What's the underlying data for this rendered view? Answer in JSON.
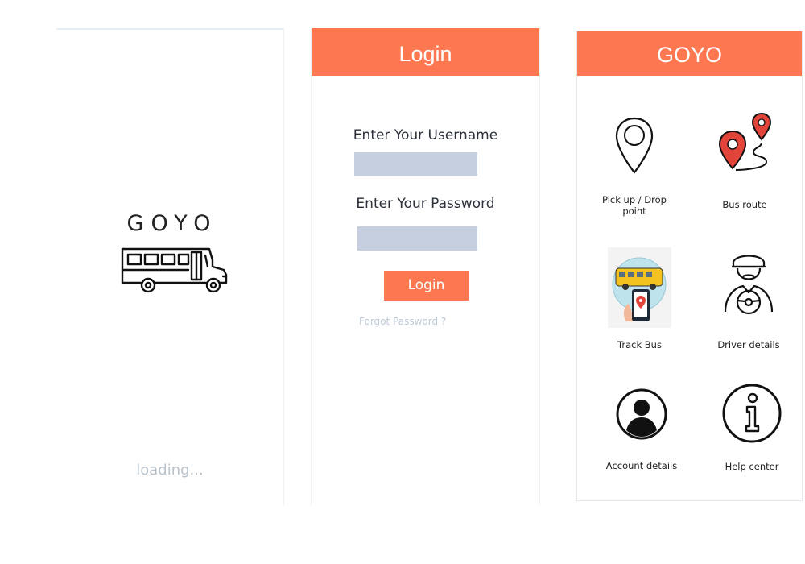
{
  "splash": {
    "brand": "GOYO",
    "loading_text": "loading..."
  },
  "login": {
    "title": "Login",
    "username_label": "Enter Your Username",
    "username_value": "",
    "password_label": "Enter Your Password",
    "password_value": "",
    "submit_label": "Login",
    "forgot_label": "Forgot Password ?"
  },
  "menu": {
    "title": "GOYO",
    "tiles": [
      {
        "label": "Pick up / Drop point",
        "icon": "map-pin-icon"
      },
      {
        "label": "Bus route",
        "icon": "route-icon"
      },
      {
        "label": "Track Bus",
        "icon": "track-bus-icon"
      },
      {
        "label": "Driver details",
        "icon": "driver-icon"
      },
      {
        "label": "Account details",
        "icon": "account-icon"
      },
      {
        "label": "Help center",
        "icon": "info-icon"
      }
    ]
  },
  "colors": {
    "accent": "#fd7751",
    "input_fill": "#c5cfdf",
    "pin_red": "#e2443a",
    "track_bus_yellow": "#f3c21f",
    "track_bus_bg": "#bfe3ec"
  }
}
